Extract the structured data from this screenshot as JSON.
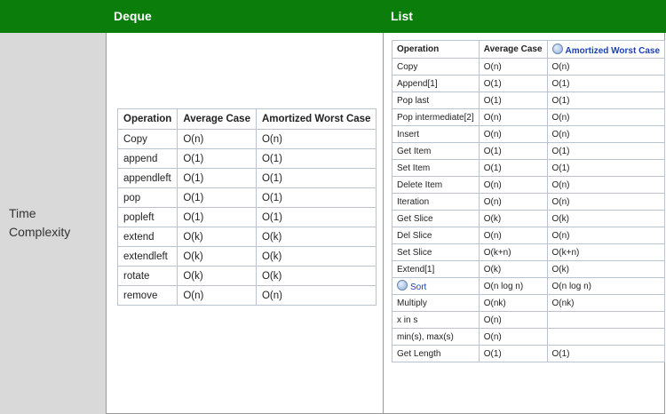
{
  "header": {
    "col1": "",
    "col2": "Deque",
    "col3": "List"
  },
  "row_label": "Time Complexity",
  "deque": {
    "headers": [
      "Operation",
      "Average Case",
      "Amortized Worst Case"
    ],
    "rows": [
      [
        "Copy",
        "O(n)",
        "O(n)"
      ],
      [
        "append",
        "O(1)",
        "O(1)"
      ],
      [
        "appendleft",
        "O(1)",
        "O(1)"
      ],
      [
        "pop",
        "O(1)",
        "O(1)"
      ],
      [
        "popleft",
        "O(1)",
        "O(1)"
      ],
      [
        "extend",
        "O(k)",
        "O(k)"
      ],
      [
        "extendleft",
        "O(k)",
        "O(k)"
      ],
      [
        "rotate",
        "O(k)",
        "O(k)"
      ],
      [
        "remove",
        "O(n)",
        "O(n)"
      ]
    ]
  },
  "list": {
    "headers": [
      "Operation",
      "Average Case",
      "Amortized Worst Case"
    ],
    "header_icons": [
      "",
      "",
      "globe-icon"
    ],
    "rows": [
      [
        "Copy",
        "O(n)",
        "O(n)"
      ],
      [
        "Append[1]",
        "O(1)",
        "O(1)"
      ],
      [
        "Pop last",
        "O(1)",
        "O(1)"
      ],
      [
        "Pop intermediate[2]",
        "O(n)",
        "O(n)"
      ],
      [
        "Insert",
        "O(n)",
        "O(n)"
      ],
      [
        "Get Item",
        "O(1)",
        "O(1)"
      ],
      [
        "Set Item",
        "O(1)",
        "O(1)"
      ],
      [
        "Delete Item",
        "O(n)",
        "O(n)"
      ],
      [
        "Iteration",
        "O(n)",
        "O(n)"
      ],
      [
        "Get Slice",
        "O(k)",
        "O(k)"
      ],
      [
        "Del Slice",
        "O(n)",
        "O(n)"
      ],
      [
        "Set Slice",
        "O(k+n)",
        "O(k+n)"
      ],
      [
        "Extend[1]",
        "O(k)",
        "O(k)"
      ],
      [
        "Sort",
        "O(n log n)",
        "O(n log n)"
      ],
      [
        "Multiply",
        "O(nk)",
        "O(nk)"
      ],
      [
        "x in s",
        "O(n)",
        ""
      ],
      [
        "min(s), max(s)",
        "O(n)",
        ""
      ],
      [
        "Get Length",
        "O(1)",
        "O(1)"
      ]
    ],
    "link_rows": [
      13
    ]
  },
  "colors": {
    "header_bg": "#0a7d0a",
    "label_bg": "#d9d9d9",
    "link": "#1a3fb5",
    "table_border": "#b9c3d1"
  }
}
